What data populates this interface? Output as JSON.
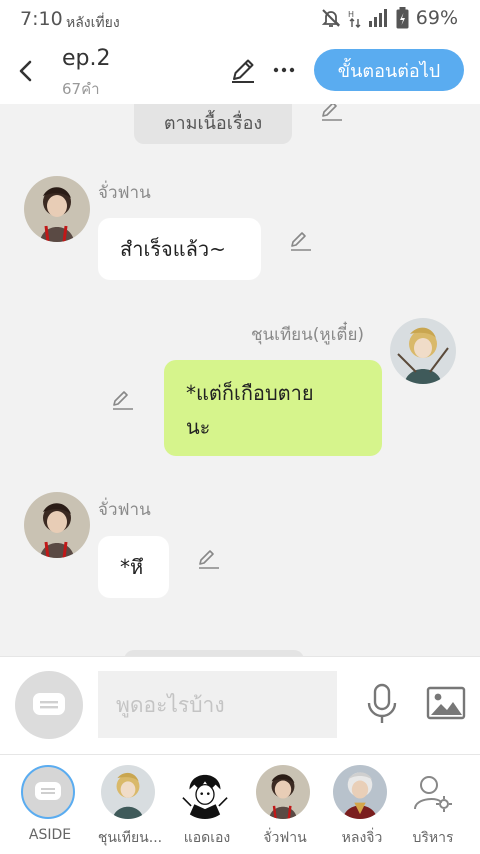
{
  "status_bar": {
    "time": "7:10",
    "period": "หลังเที่ยง",
    "battery": "69%"
  },
  "header": {
    "title": "ep.2",
    "subtitle": "67คำ",
    "next_label": "ขั้นตอนต่อไป"
  },
  "chat": {
    "narration": "ตามเนื้อเรื่อง",
    "messages": [
      {
        "sender": "จั่วฟาน",
        "text": "สำเร็จแล้ว~",
        "side": "left"
      },
      {
        "sender": "ชุนเทียน(หูเตี๋ย)",
        "text": "*แต่ก็เกือบตายนะ",
        "line1": "*แต่ก็เกือบตาย",
        "line2": "นะ",
        "side": "right"
      },
      {
        "sender": "จั่วฟาน",
        "text": "*หึ",
        "side": "left"
      }
    ]
  },
  "input": {
    "placeholder": "พูดอะไรบ้าง"
  },
  "characters": [
    {
      "label": "ASIDE",
      "selected": true
    },
    {
      "label": "ชุนเทียน..."
    },
    {
      "label": "แอดเอง"
    },
    {
      "label": "จั่วฟาน"
    },
    {
      "label": "หลงจิ่ว"
    },
    {
      "label": "บริหาร"
    }
  ],
  "colors": {
    "accent": "#5aacf0",
    "my_bubble": "#d6f48c",
    "background": "#f2f2f2"
  }
}
